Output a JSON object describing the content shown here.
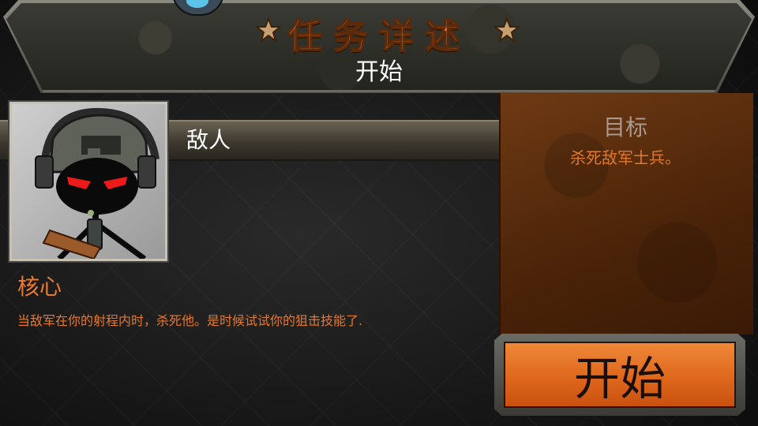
{
  "header": {
    "title": "任务详述",
    "subtitle": "开始"
  },
  "enemy": {
    "label": "敌人",
    "portrait_icon": "stickman-soldier-portrait"
  },
  "goal": {
    "title": "目标",
    "text": "杀死敌军士兵。"
  },
  "core": {
    "title": "核心",
    "text": "当敌军在你的射程内时，杀死他。是时候试试你的狙击技能了."
  },
  "start_button": {
    "label": "开始"
  },
  "colors": {
    "accent_orange": "#e8752a",
    "button_orange": "#e06a1e",
    "panel_brown": "#5a2d0c"
  }
}
